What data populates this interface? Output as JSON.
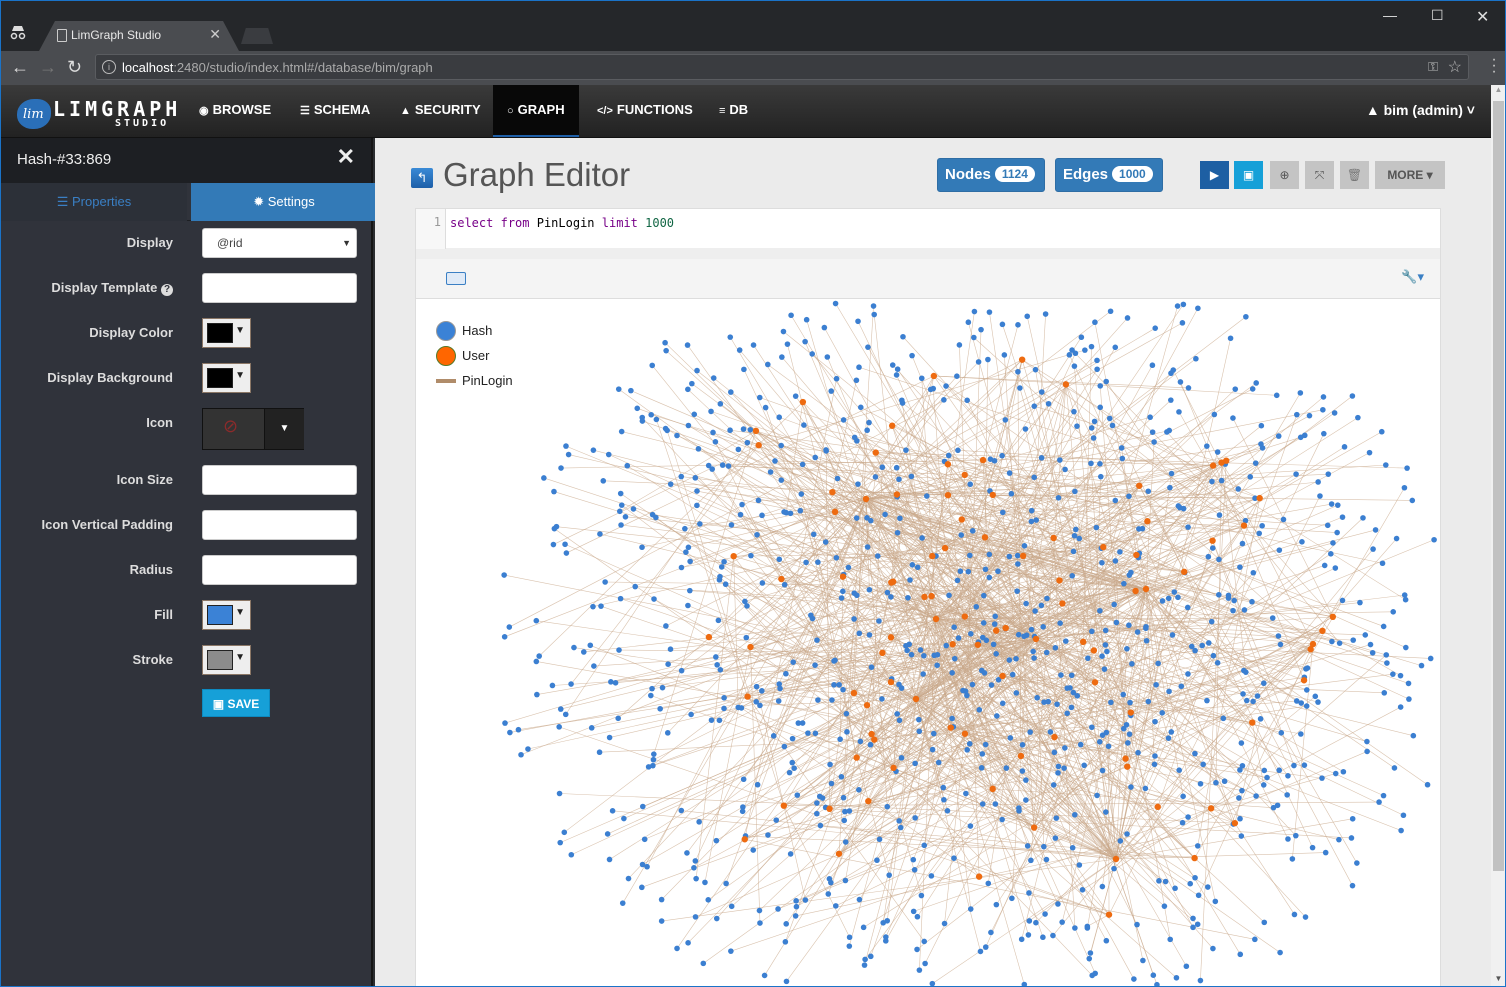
{
  "browser": {
    "tab_title": "LimGraph Studio",
    "url_host": "localhost",
    "url_rest": ":2480/studio/index.html#/database/bim/graph",
    "icons": [
      "incognito-icon",
      "document-icon",
      "close-tab-icon",
      "back-icon",
      "forward-icon",
      "reload-icon",
      "info-icon",
      "key-icon",
      "star-icon",
      "menu-icon",
      "minimize-icon",
      "maximize-icon",
      "close-window-icon"
    ]
  },
  "navbar": {
    "logo_mark": "lim",
    "logo_name": "LIMGRAPH",
    "logo_sub": "STUDIO",
    "items": [
      {
        "label": "BROWSE",
        "icon": "eye-icon",
        "glyph": "◉"
      },
      {
        "label": "SCHEMA",
        "icon": "table-icon",
        "glyph": "☰"
      },
      {
        "label": "SECURITY",
        "icon": "user-icon",
        "glyph": "👤"
      },
      {
        "label": "GRAPH",
        "icon": "circle-icon",
        "glyph": "○",
        "active": true
      },
      {
        "label": "FUNCTIONS",
        "icon": "code-icon",
        "glyph": "</>"
      },
      {
        "label": "DB",
        "icon": "database-icon",
        "glyph": "≡"
      }
    ],
    "user": "bim (admin)"
  },
  "sidebar": {
    "title": "Hash-#33:869",
    "tabs": {
      "properties": "Properties",
      "settings": "Settings"
    },
    "fields": {
      "display": {
        "label": "Display",
        "value": "@rid"
      },
      "display_template": {
        "label": "Display Template",
        "value": ""
      },
      "display_color": {
        "label": "Display Color",
        "color": "#000000"
      },
      "display_background": {
        "label": "Display Background",
        "color": "#000000"
      },
      "icon": {
        "label": "Icon"
      },
      "icon_size": {
        "label": "Icon Size",
        "value": ""
      },
      "icon_vertical_padding": {
        "label": "Icon Vertical Padding",
        "value": ""
      },
      "radius": {
        "label": "Radius",
        "value": ""
      },
      "fill": {
        "label": "Fill",
        "color": "#3b82d6"
      },
      "stroke": {
        "label": "Stroke",
        "color": "#8c8c8c"
      }
    },
    "save_label": "SAVE"
  },
  "main": {
    "title": "Graph Editor",
    "nodes_label": "Nodes",
    "nodes_count": "1124",
    "edges_label": "Edges",
    "edges_count": "1000",
    "more_label": "MORE",
    "query_line_no": "1",
    "query": {
      "kw1": "select",
      "kw2": "from",
      "ident": "PinLogin",
      "kw3": "limit",
      "num": "1000"
    },
    "legend": [
      {
        "label": "Hash",
        "color": "#3b82d6",
        "stroke": "#999999"
      },
      {
        "label": "User",
        "color": "#ff6600",
        "stroke": "#557a2a"
      },
      {
        "label": "PinLogin",
        "color": "#b08c6a",
        "type": "edge"
      }
    ],
    "graph_colors": {
      "hash": "#3b7fd1",
      "user": "#ee6b10",
      "edge": "#c9a88a"
    }
  }
}
